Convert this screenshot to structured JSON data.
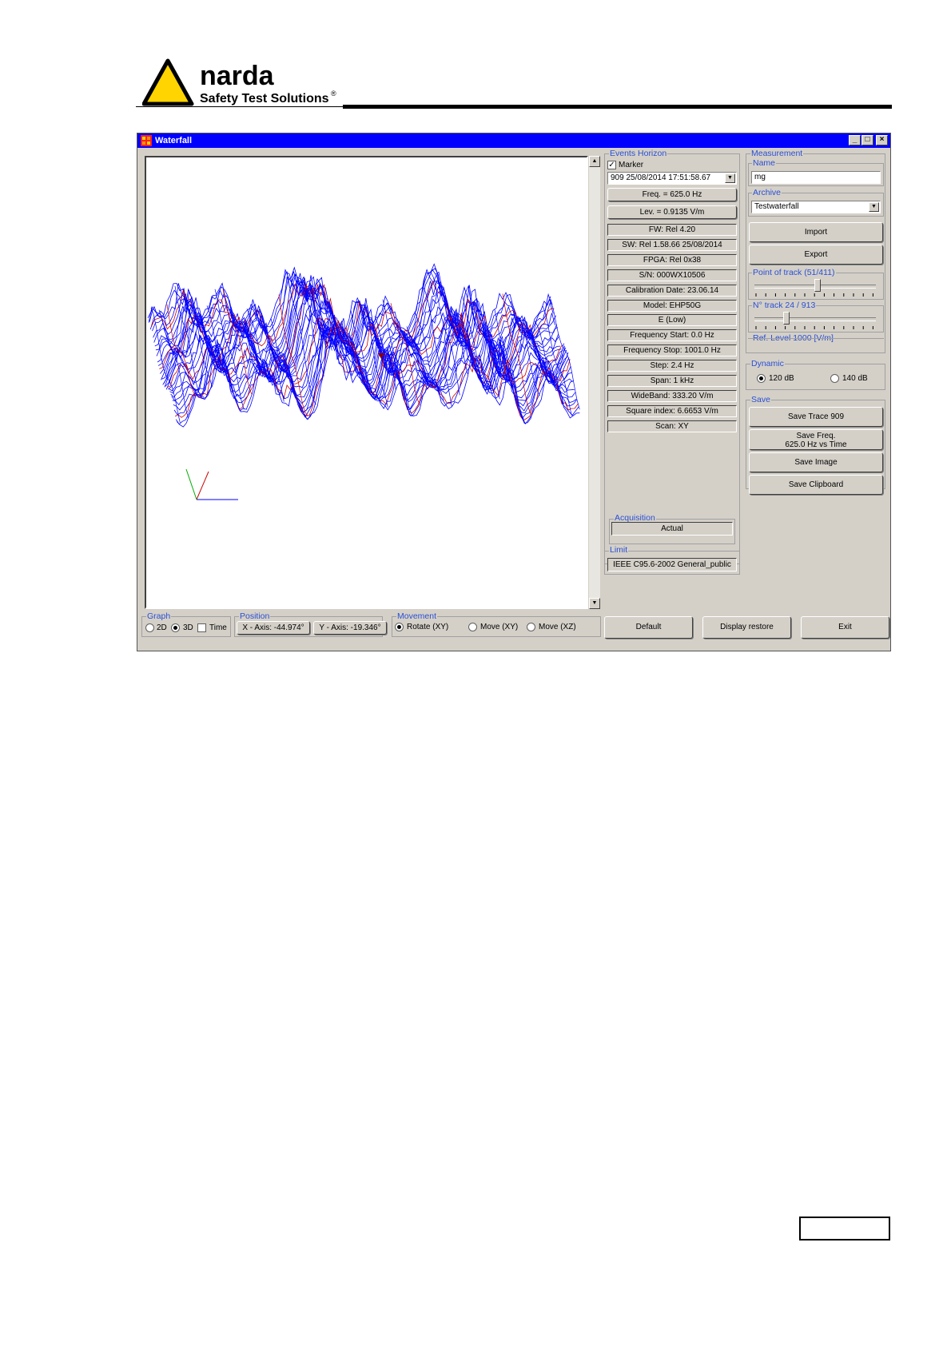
{
  "header": {
    "brand": "narda",
    "tagline": "Safety Test Solutions",
    "registered": "®"
  },
  "window": {
    "title": "Waterfall",
    "controls": {
      "minimize": "_",
      "maximize": "□",
      "close": "×"
    }
  },
  "events_horizon": {
    "label": "Events Horizon",
    "marker_label": "Marker",
    "marker_checked": true,
    "event_select": "909   25/08/2014 17:51:58.67",
    "freq_button": "Freq. = 625.0 Hz",
    "lev_button": "Lev. = 0.9135 V/m",
    "info": [
      "FW: Rel 4.20",
      "SW: Rel 1.58.66 25/08/2014",
      "FPGA: Rel 0x38",
      "S/N: 000WX10506",
      "Calibration Date: 23.06.14",
      "Model: EHP50G",
      "E (Low)",
      "Frequency Start: 0.0 Hz",
      "Frequency Stop: 1001.0 Hz",
      "Step: 2.4 Hz",
      "Span: 1 kHz",
      "WideBand: 333.20 V/m",
      "Square index: 6.6653 V/m",
      "Scan: XY"
    ]
  },
  "acquisition": {
    "label": "Acquisition",
    "value": "Actual"
  },
  "limit": {
    "label": "Limit",
    "value": "IEEE C95.6-2002 General_public"
  },
  "measurement": {
    "label": "Measurement",
    "name_label": "Name",
    "name_value": "mg",
    "archive_label": "Archive",
    "archive_value": "Testwaterfall",
    "import_button": "Import",
    "export_button": "Export",
    "point_of_track_label": "Point of track (51/411)",
    "point_of_track_fraction": 0.52,
    "track_label": "N° track 24 / 913",
    "track_fraction": 0.25,
    "ref_level_label": "Ref. Level 1000 [V/m]"
  },
  "dynamic": {
    "label": "Dynamic",
    "options": [
      "120 dB",
      "140 dB"
    ],
    "selected": "120 dB"
  },
  "save": {
    "label": "Save",
    "trace_button": "Save Trace 909",
    "freq_button_line1": "Save Freq.",
    "freq_button_line2": "625.0 Hz  vs  Time",
    "image_button": "Save Image",
    "clipboard_button": "Save Clipboard"
  },
  "graph": {
    "label": "Graph",
    "options": [
      "2D",
      "3D"
    ],
    "selected": "3D",
    "time_label": "Time",
    "time_checked": false
  },
  "position": {
    "label": "Position",
    "x_axis": "X - Axis: -44.974°",
    "y_axis": "Y - Axis: -19.346°"
  },
  "movement": {
    "label": "Movement",
    "options": [
      "Rotate (XY)",
      "Move (XY)",
      "Move (XZ)"
    ],
    "selected": "Rotate (XY)"
  },
  "bottom_buttons": {
    "default": "Default",
    "display_restore": "Display restore",
    "exit": "Exit"
  },
  "colors": {
    "title_bar": "#0000ff",
    "wire_primary": "#0000ff",
    "wire_highlight": "#cc0000",
    "group_label": "#2a4fd4",
    "window_face": "#d4d0c8"
  }
}
